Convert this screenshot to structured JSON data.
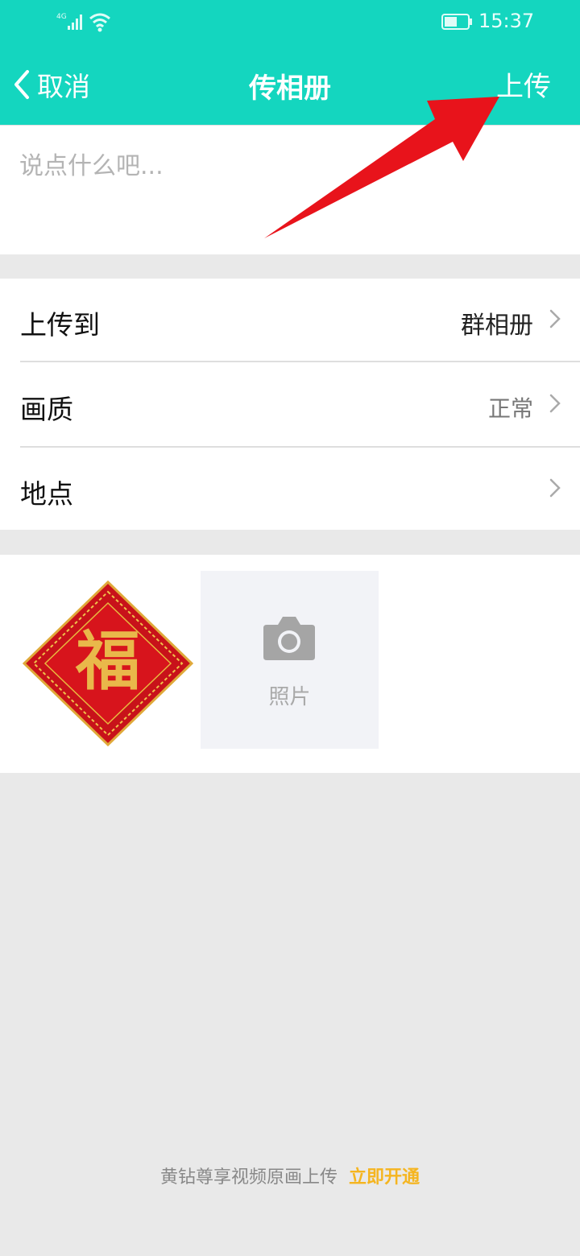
{
  "status_bar": {
    "network": "4G",
    "time": "15:37"
  },
  "nav": {
    "back_label": "取消",
    "title": "传相册",
    "action_label": "上传"
  },
  "description": {
    "placeholder": "说点什么吧...",
    "value": ""
  },
  "settings": [
    {
      "label": "上传到",
      "value": "群相册"
    },
    {
      "label": "画质",
      "value": "正常"
    },
    {
      "label": "地点",
      "value": ""
    }
  ],
  "media": {
    "thumbnail_glyph": "福",
    "add_label": "照片"
  },
  "footer": {
    "text": "黄钻尊享视频原画上传",
    "link": "立即开通"
  },
  "colors": {
    "header": "#14d6bf",
    "accent_link": "#f5b520",
    "annotation_arrow": "#e8131b"
  },
  "icons": [
    "signal-icon",
    "wifi-icon",
    "battery-icon",
    "back-chevron-icon",
    "chevron-right-icon",
    "camera-icon"
  ]
}
